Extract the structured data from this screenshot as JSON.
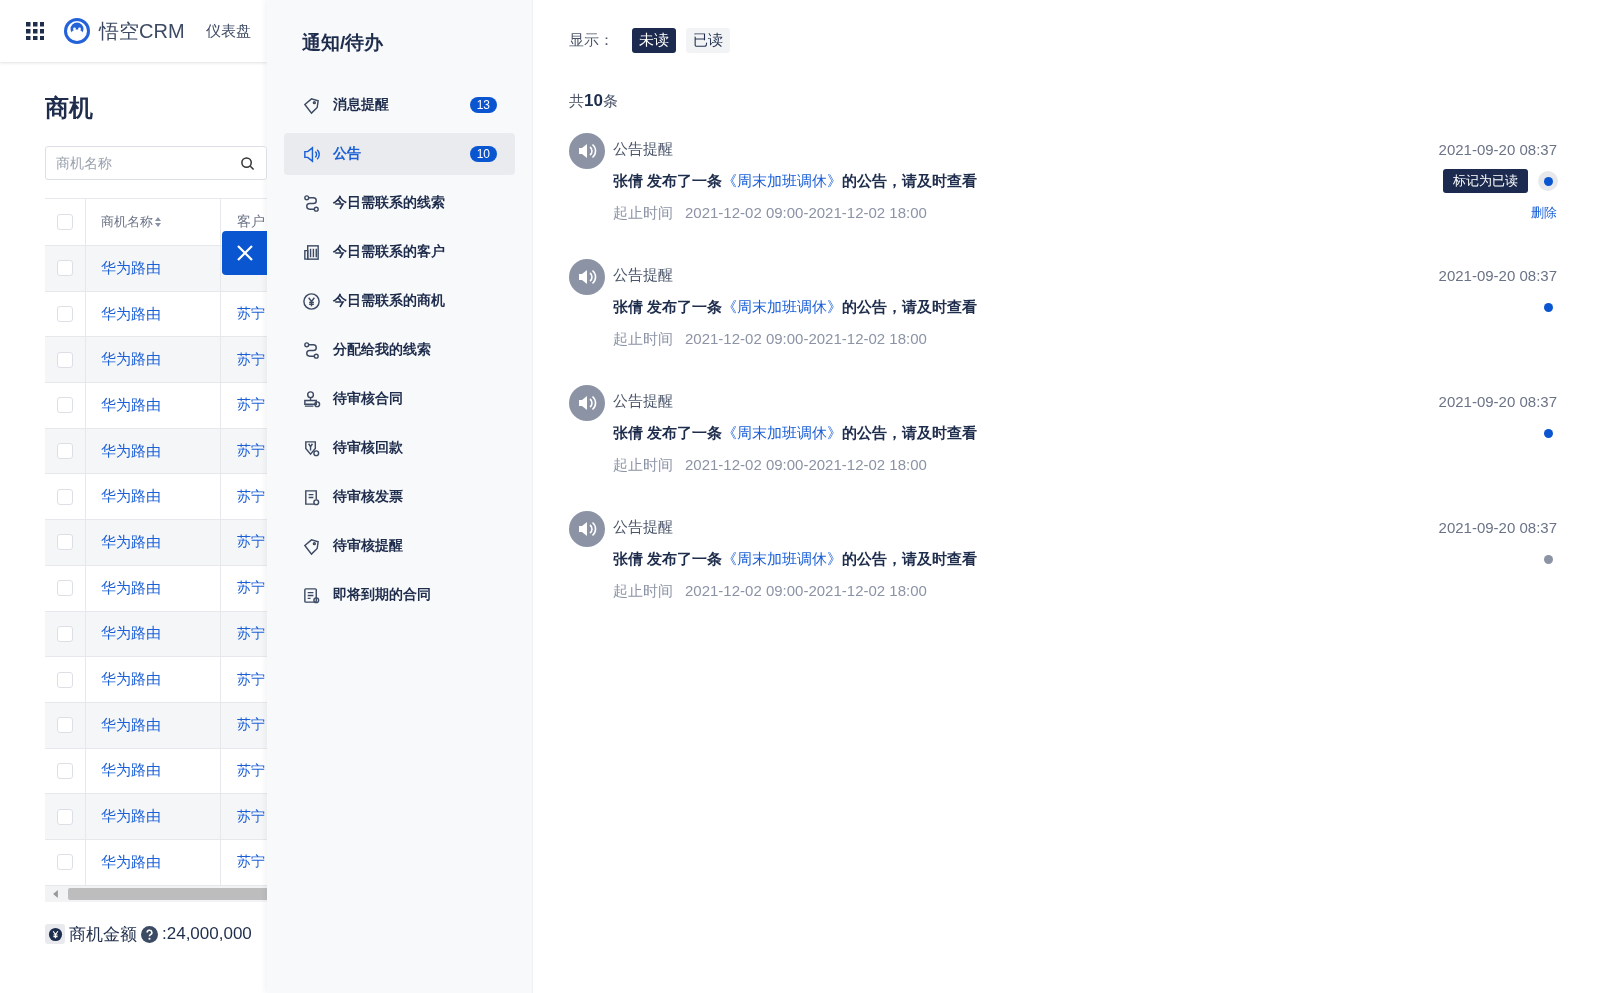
{
  "app": {
    "brand": "悟空CRM",
    "nav": [
      "仪表盘"
    ]
  },
  "page": {
    "title": "商机",
    "search": {
      "placeholder": "商机名称"
    },
    "table": {
      "columns": [
        "商机名称",
        "客户"
      ],
      "all_checked": false,
      "rows": [
        {
          "name": "华为路由",
          "checked": false
        },
        {
          "name": "华为路由",
          "customer": "苏宁",
          "checked": false
        },
        {
          "name": "华为路由",
          "customer": "苏宁",
          "checked": false
        },
        {
          "name": "华为路由",
          "customer": "苏宁",
          "checked": false
        },
        {
          "name": "华为路由",
          "customer": "苏宁",
          "checked": false
        },
        {
          "name": "华为路由",
          "customer": "苏宁",
          "checked": false
        },
        {
          "name": "华为路由",
          "customer": "苏宁",
          "checked": false
        },
        {
          "name": "华为路由",
          "customer": "苏宁",
          "checked": false
        },
        {
          "name": "华为路由",
          "customer": "苏宁",
          "checked": false
        },
        {
          "name": "华为路由",
          "customer": "苏宁",
          "checked": false
        },
        {
          "name": "华为路由",
          "customer": "苏宁",
          "checked": false
        },
        {
          "name": "华为路由",
          "customer": "苏宁",
          "checked": false
        },
        {
          "name": "华为路由",
          "customer": "苏宁",
          "checked": false
        },
        {
          "name": "华为路由",
          "customer": "苏宁",
          "checked": false
        }
      ]
    },
    "summary": {
      "label": "商机金额",
      "value": ":24,000,000"
    }
  },
  "drawer": {
    "title": "通知/待办",
    "menu": [
      {
        "label": "消息提醒",
        "badge": "13",
        "selected": false
      },
      {
        "label": "公告",
        "badge": "10",
        "selected": true
      },
      {
        "label": "今日需联系的线索",
        "selected": false
      },
      {
        "label": "今日需联系的客户",
        "selected": false
      },
      {
        "label": "今日需联系的商机",
        "selected": false
      },
      {
        "label": "分配给我的线索",
        "selected": false
      },
      {
        "label": "待审核合同",
        "selected": false
      },
      {
        "label": "待审核回款",
        "selected": false
      },
      {
        "label": "待审核发票",
        "selected": false
      },
      {
        "label": "待审核提醒",
        "selected": false
      },
      {
        "label": "即将到期的合同",
        "selected": false
      }
    ]
  },
  "content": {
    "filter_label": "显示：",
    "filters": [
      {
        "label": "未读",
        "selected": true
      },
      {
        "label": "已读",
        "selected": false
      }
    ],
    "count": "共**10**条",
    "notices": [
      {
        "title": "公告提醒",
        "date": "2021-09-20 08:37",
        "sender": "张倩",
        "message_before": "发布了一条",
        "link": "《周末加班调休》",
        "message_after": "的公告，请及时查看",
        "time_label": "起止时间",
        "time": "2021-12-02 09:00-2021-12-02 18:00",
        "unread": true,
        "mark_read": "标记为已读",
        "delete": "删除"
      },
      {
        "title": "公告提醒",
        "date": "2021-09-20 08:37",
        "sender": "张倩",
        "message_before": "发布了一条",
        "link": "《周末加班调休》",
        "message_after": "的公告，请及时查看",
        "time_label": "起止时间",
        "time": "2021-12-02 09:00-2021-12-02 18:00",
        "unread": true
      },
      {
        "title": "公告提醒",
        "date": "2021-09-20 08:37",
        "sender": "张倩",
        "message_before": "发布了一条",
        "link": "《周末加班调休》",
        "message_after": "的公告，请及时查看",
        "time_label": "起止时间",
        "time": "2021-12-02 09:00-2021-12-02 18:00",
        "unread": true
      },
      {
        "title": "公告提醒",
        "date": "2021-09-20 08:37",
        "sender": "张倩",
        "message_before": "发布了一条",
        "link": "《周末加班调休》",
        "message_after": "的公告，请及时查看",
        "time_label": "起止时间",
        "time": "2021-12-02 09:00-2021-12-02 18:00",
        "unread": false
      }
    ]
  }
}
